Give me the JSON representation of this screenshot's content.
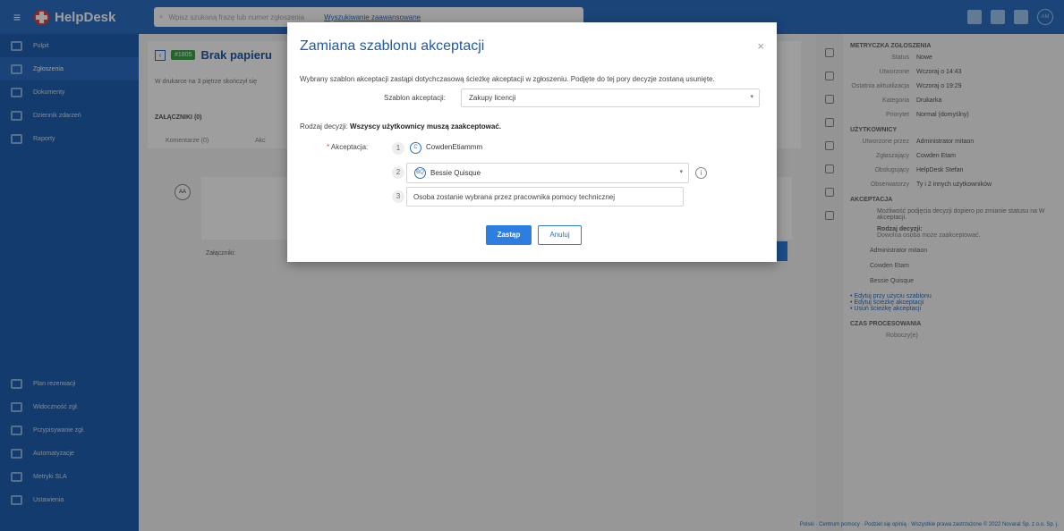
{
  "topbar": {
    "brand": "HelpDesk",
    "search_placeholder": "Wpisz szukaną frazę lub numer zgłoszenia",
    "search_link": "Wyszukiwanie zaawansowane",
    "avatar": "AM"
  },
  "sidebar": {
    "items": [
      {
        "label": "Pulpit",
        "icon": "dashboard-icon"
      },
      {
        "label": "Zgłoszenia",
        "icon": "tickets-icon",
        "active": true
      },
      {
        "label": "Dokumenty",
        "icon": "documents-icon"
      },
      {
        "label": "Dziennik zdarzeń",
        "icon": "log-icon"
      },
      {
        "label": "Raporty",
        "icon": "reports-icon"
      }
    ],
    "bottom_items": [
      {
        "label": "Plan rezerwacji",
        "icon": "calendar-icon"
      },
      {
        "label": "Widoczność zgł.",
        "icon": "visibility-icon"
      },
      {
        "label": "Przypisywanie zgł.",
        "icon": "assign-icon"
      },
      {
        "label": "Automatyzacje",
        "icon": "automation-icon"
      },
      {
        "label": "Metryki SLA",
        "icon": "sla-icon"
      },
      {
        "label": "Ustawienia",
        "icon": "settings-icon"
      }
    ]
  },
  "ticket": {
    "id": "#1805",
    "title": "Brak papieru",
    "desc": "W drukarce na 3 piętrze skończył się",
    "attachments": "ZAŁĄCZNIKI (0)",
    "tab1": "Komentarze (0)",
    "tab2": "Akc",
    "attach_label": "Załączniki:",
    "avatar": "AA"
  },
  "right": {
    "metryczka": "METRYCZKA ZGŁOSZENIA",
    "rows": [
      {
        "k": "Status",
        "v": "Nowe"
      },
      {
        "k": "Utworzone",
        "v": "Wczoraj o 14:43"
      },
      {
        "k": "Ostatnia aktualizacja",
        "v": "Wczoraj o 19:29"
      },
      {
        "k": "Kategoria",
        "v": "Drukarka"
      },
      {
        "k": "Priorytet",
        "v": "Normal (domyślny)"
      }
    ],
    "users_head": "UŻYTKOWNICY",
    "users": [
      {
        "k": "Utworzone przez",
        "v": "Administrator mitaon"
      },
      {
        "k": "Zgłaszający",
        "v": "Cowden Etam"
      },
      {
        "k": "Obsługujący",
        "v": "HelpDesk Stefan"
      },
      {
        "k": "Obserwatorzy",
        "v": "Ty i 2 innych użytkowników"
      }
    ],
    "akcept_head": "AKCEPTACJA",
    "akcept_info": "Możliwość podjęcia decyzji dopiero po zmianie statusu na W akceptacji.",
    "decision_label": "Rodzaj decyzji:",
    "decision_value": "Dowolna osoba może zaakceptować.",
    "people": [
      "Administrator mitaon",
      "Cowden Etam",
      "Bessie Quisque"
    ],
    "links": [
      "• Edytuj przy użyciu szablonu",
      "• Edytuj ścieżkę akceptacji",
      "• Usuń ścieżkę akceptacji"
    ],
    "czas_head": "CZAS PROCESOWANIA",
    "czas_sub": "Roboczy(e)"
  },
  "footer": {
    "text": "Polski · Centrum pomocy · Podziel się opinią · Wszystkie prawa zastrzeżone © 2022 Novaral Sp. z o.o. Sp. j."
  },
  "modal": {
    "title": "Zamiana szablonu akceptacji",
    "close": "×",
    "description": "Wybrany szablon akceptacji zastąpi dotychczasową ścieżkę akceptacji w zgłoszeniu. Podjęte do tej pory decyzje zostaną usunięte.",
    "template_label": "Szablon akceptacji:",
    "template_value": "Zakupy licencji",
    "decision_prefix": "Rodzaj decyzji: ",
    "decision_value": "Wszyscy użytkownicy muszą zaakceptować.",
    "approval_label": "Akceptacja:",
    "required_mark": "*",
    "steps": [
      {
        "num": "1",
        "avatar": "C",
        "name": "CowdenEtiammm"
      },
      {
        "num": "2",
        "avatar": "BQ",
        "name": "Bessie Quisque"
      },
      {
        "num": "3",
        "placeholder": "Osoba zostanie wybrana przez pracownika pomocy technicznej"
      }
    ],
    "info_icon": "i",
    "submit": "Zastąp",
    "cancel": "Anuluj"
  }
}
